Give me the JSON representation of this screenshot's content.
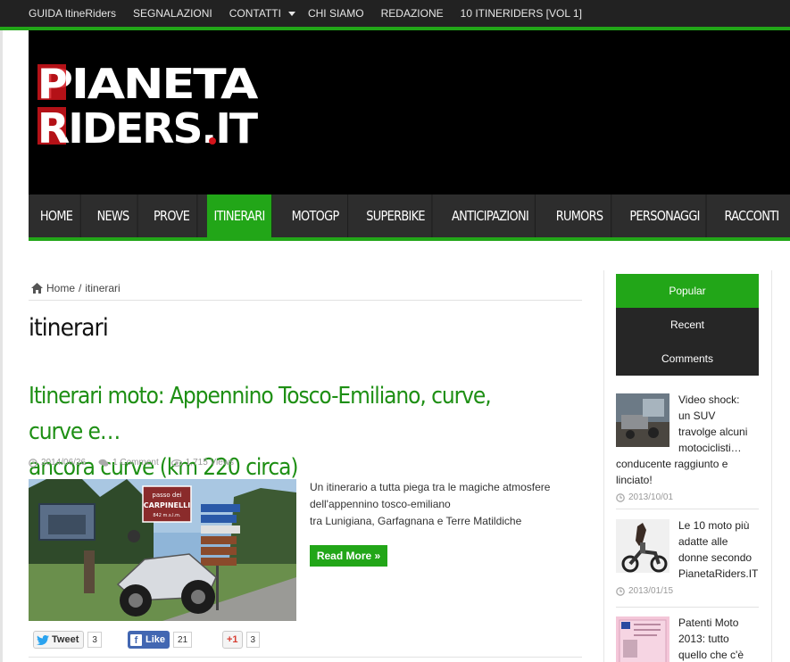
{
  "topnav": {
    "items": [
      {
        "label": "GUIDA ItineRiders"
      },
      {
        "label": "SEGNALAZIONI"
      },
      {
        "label": "CONTATTI",
        "has_dropdown": true
      },
      {
        "label": "CHI SIAMO"
      },
      {
        "label": "REDAZIONE"
      },
      {
        "label": "10 ITINERIDERS [VOL 1]"
      }
    ]
  },
  "logo": {
    "line1": "PIANETA",
    "line2": "RIDERS.IT"
  },
  "mainnav": {
    "items": [
      {
        "label": "HOME"
      },
      {
        "label": "NEWS"
      },
      {
        "label": "PROVE"
      },
      {
        "label": "ITINERARI",
        "active": true
      },
      {
        "label": "MOTOGP"
      },
      {
        "label": "SUPERBIKE"
      },
      {
        "label": "ANTICIPAZIONI"
      },
      {
        "label": "RUMORS"
      },
      {
        "label": "PERSONAGGI"
      },
      {
        "label": "RACCONTI"
      }
    ]
  },
  "breadcrumb": {
    "home": "Home",
    "separator": "/",
    "current": "itinerari"
  },
  "page_title": "itinerari",
  "post": {
    "title_line1": "Itinerari moto: Appennino Tosco-Emiliano, curve, curve e…",
    "title_line2": "ancora curve (km 220 circa)",
    "date": "2014/06/26",
    "comments": "1 Comment",
    "views": "1,715 Views",
    "excerpt_line1": "Un itinerario a tutta piega tra le magiche atmosfere",
    "excerpt_line2": "dell'appennino tosco-emiliano",
    "excerpt_line3": "tra Lunigiana, Garfagnana e Terre Matildiche",
    "read_more": "Read More »",
    "image_sign": {
      "line1": "passo dei",
      "line2": "CARPINELLI",
      "line3": "842 m.s.l.m."
    }
  },
  "share": {
    "tweet_label": "Tweet",
    "tweet_count": "3",
    "like_label": "Like",
    "like_count": "21",
    "gplus_label": "+1",
    "gplus_count": "3"
  },
  "sidebar": {
    "tabs": [
      {
        "label": "Popular",
        "active": true
      },
      {
        "label": "Recent"
      },
      {
        "label": "Comments"
      }
    ],
    "items": [
      {
        "line1": "Video shock:",
        "line2": "un SUV",
        "line3": "travolge alcuni",
        "line4": "motociclisti…",
        "line5": "conducente raggiunto e",
        "line6": "linciato!",
        "date": "2013/10/01"
      },
      {
        "line1": "Le 10 moto più",
        "line2": "adatte alle",
        "line3": "donne secondo",
        "line4": "PianetaRiders.IT",
        "date": "2013/01/15"
      },
      {
        "line1": "Patenti Moto",
        "line2": "2013: tutto",
        "line3": "quello che c'è"
      }
    ]
  },
  "colors": {
    "accent": "#22a618",
    "nav_dark": "#2d2d2d",
    "topbar": "#222222",
    "title_green": "#1e8f14"
  }
}
